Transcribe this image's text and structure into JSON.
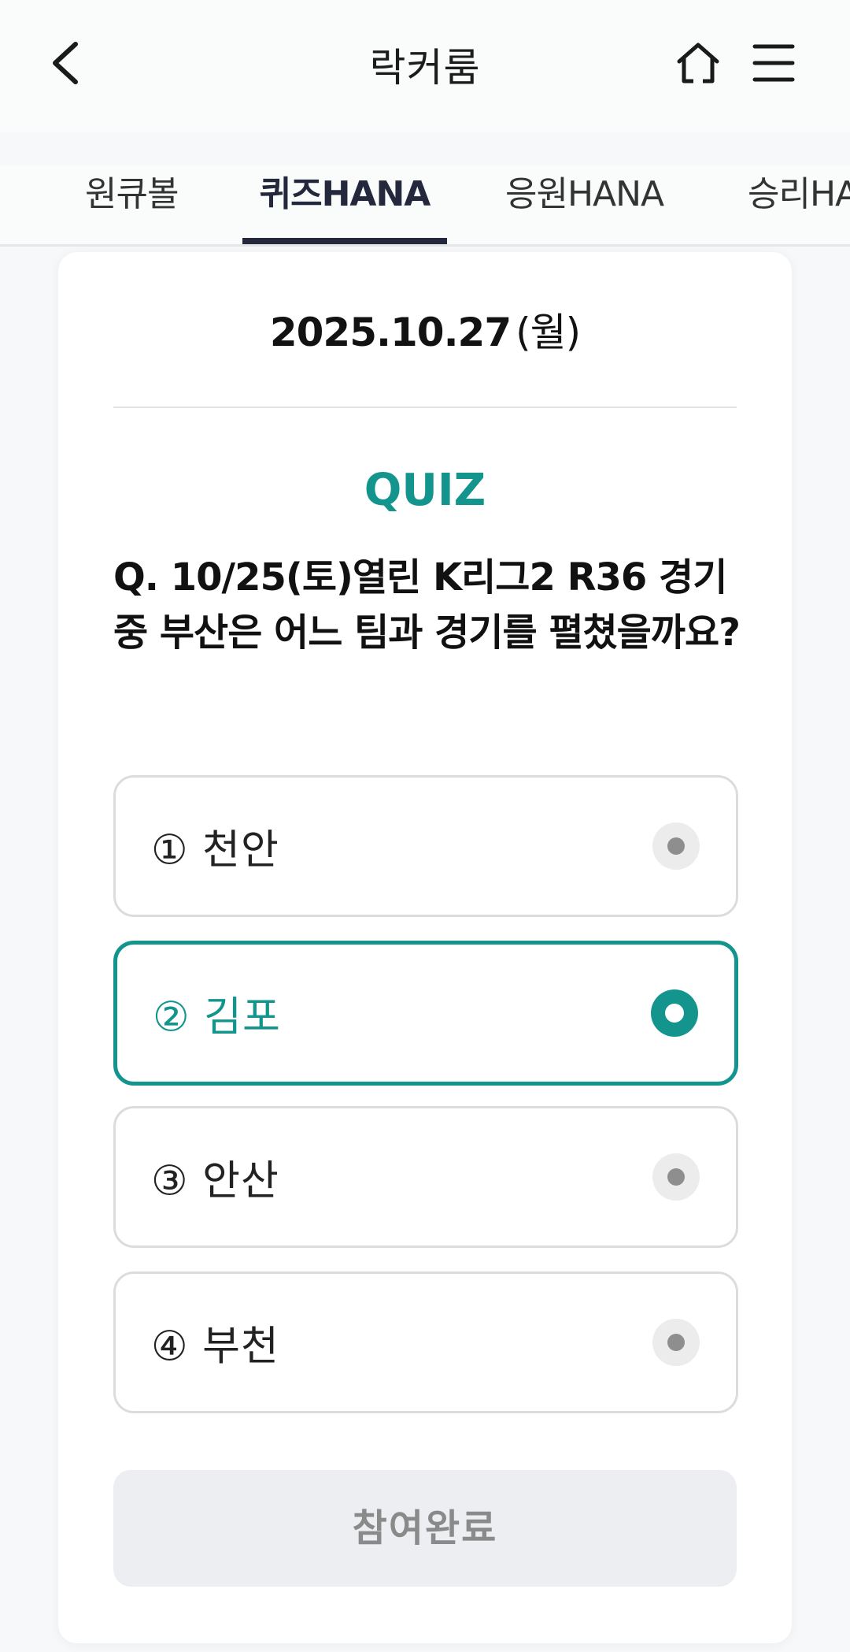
{
  "header": {
    "title": "락커룸",
    "back_icon": "chevron-left-icon",
    "home_icon": "home-icon",
    "menu_icon": "hamburger-menu-icon"
  },
  "tabs": [
    {
      "label": "원큐볼",
      "active": false
    },
    {
      "label": "퀴즈HANA",
      "active": true
    },
    {
      "label": "응원HANA",
      "active": false
    },
    {
      "label": "승리HANA",
      "active": false
    }
  ],
  "quiz": {
    "date": "2025.10.27",
    "weekday": "(월)",
    "label": "QUIZ",
    "question": "Q. 10/25(토)열린 K리그2 R36 경기 중 부산은 어느 팀과 경기를 펼쳤을까요?",
    "options": [
      {
        "number": "①",
        "label": "천안",
        "selected": false
      },
      {
        "number": "②",
        "label": "김포",
        "selected": true
      },
      {
        "number": "③",
        "label": "안산",
        "selected": false
      },
      {
        "number": "④",
        "label": "부천",
        "selected": false
      }
    ],
    "submit_label": "참여완료"
  },
  "colors": {
    "accent": "#13958e",
    "tab_active": "#23283d",
    "button_disabled_bg": "#eceef2"
  }
}
